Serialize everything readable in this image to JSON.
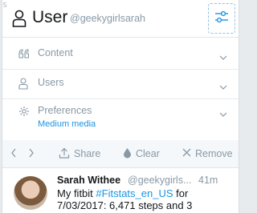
{
  "header": {
    "drag_label": "5",
    "title": "User",
    "handle": "@geekygirlsarah"
  },
  "rows": {
    "content_label": "Content",
    "users_label": "Users",
    "preferences_label": "Preferences",
    "preferences_sub": "Medium media"
  },
  "toolbar": {
    "share_label": "Share",
    "clear_label": "Clear",
    "remove_label": "Remove"
  },
  "tweet": {
    "name": "Sarah Withee",
    "handle": "@geekygirls...",
    "time": "41m",
    "text_1": "My fitbit ",
    "hashtag": "#Fitstats_en_US",
    "text_2": " for 7/03/2017: 6,471 steps and 3"
  },
  "icons": {
    "header": "user-icon",
    "options": "sliders-icon",
    "content": "quote-icon",
    "users": "user-icon",
    "preferences": "gear-icon",
    "prev": "chevron-left-icon",
    "next": "chevron-right-icon",
    "share": "upload-icon",
    "clear": "droplet-icon",
    "remove": "close-icon"
  },
  "colors": {
    "accent": "#1b95e0",
    "muted": "#8899a6"
  }
}
